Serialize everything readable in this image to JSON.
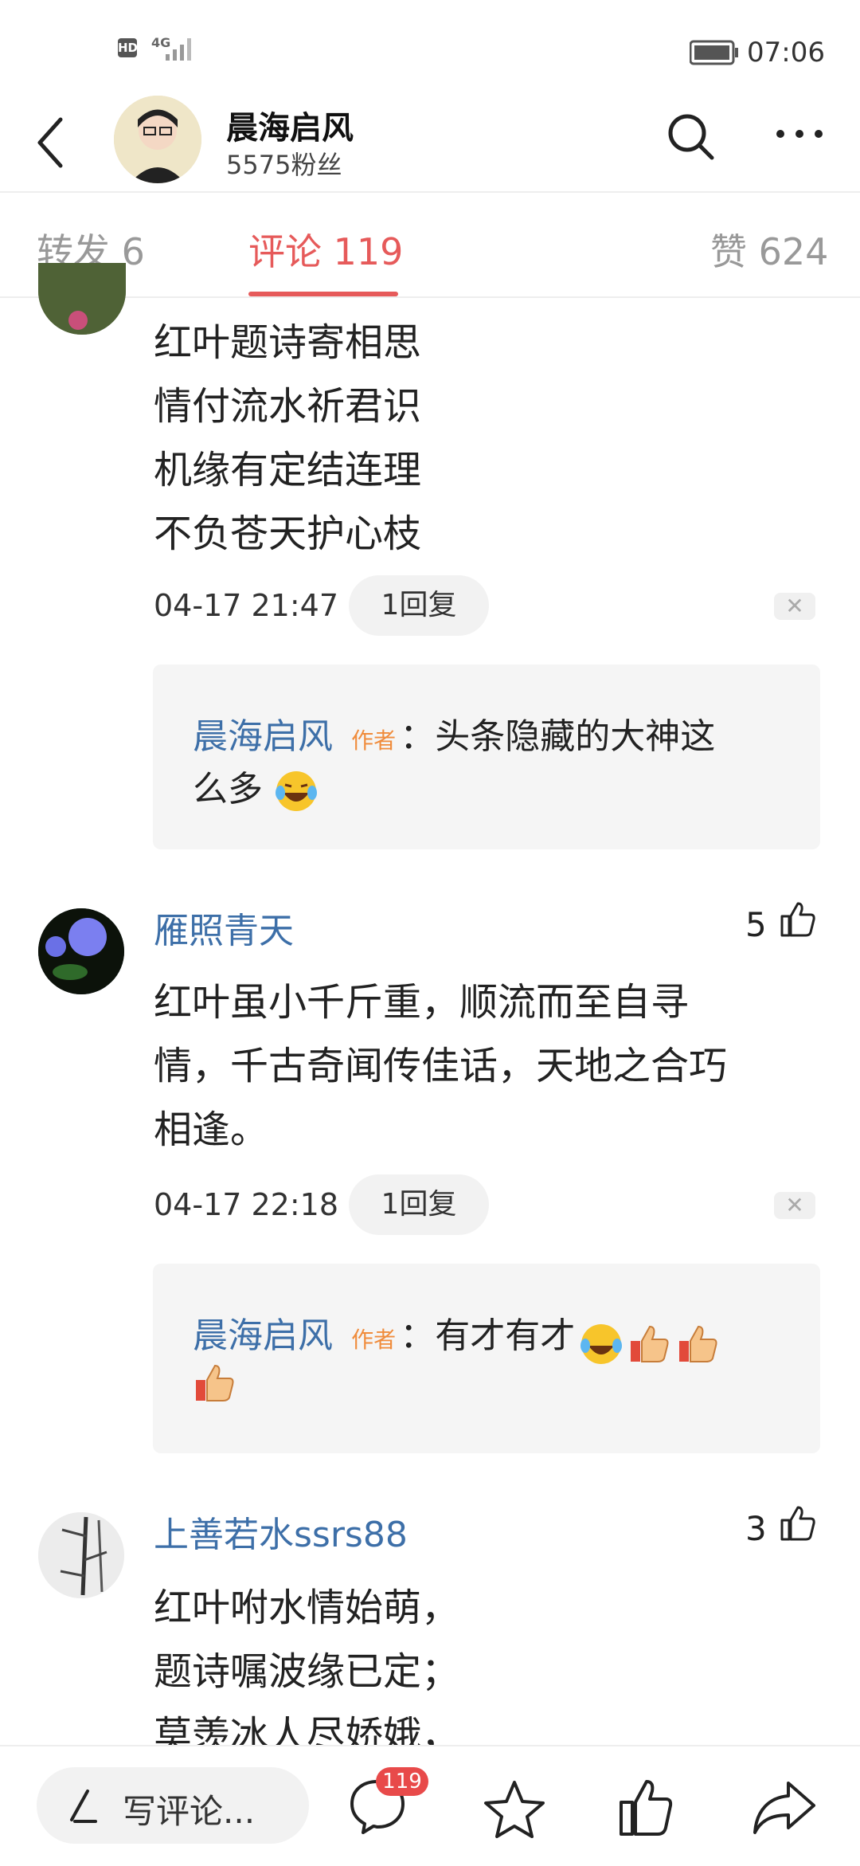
{
  "status_bar": {
    "network": "4G",
    "hd": "HD",
    "time": "07:06"
  },
  "header": {
    "name": "晨海启风",
    "followers": "5575粉丝"
  },
  "tabs": [
    {
      "label": "转发 6"
    },
    {
      "label": "评论 119"
    },
    {
      "label": "赞 624"
    }
  ],
  "comments": [
    {
      "lines": [
        "红叶题诗寄相思",
        "情付流水祈君识",
        "机缘有定结连理",
        "不负苍天护心枝"
      ],
      "time": "04-17 21:47 ·",
      "replies_label": "1回复",
      "reply": {
        "name": "晨海启风",
        "tag": "作者",
        "text1": "：头条隐藏的大神这",
        "text2": "么多"
      }
    },
    {
      "user": "雁照青天",
      "likes": "5",
      "lines": [
        "红叶虽小千斤重，顺流而至自寻",
        "情，千古奇闻传佳话，天地之合巧",
        "相逢。"
      ],
      "time": "04-17 22:18 ·",
      "replies_label": "1回复",
      "reply": {
        "name": "晨海启风",
        "tag": "作者",
        "text1": "：有才有才"
      }
    },
    {
      "user": "上善若水ssrs88",
      "likes": "3",
      "lines": [
        "红叶咐水情始萌，",
        "题诗嘱波缘已定；",
        "莫羡冰人尽娇娥，"
      ]
    }
  ],
  "bottom_bar": {
    "write_label": "写评论...",
    "comment_count": "119"
  },
  "colors": {
    "accent": "#e65a5a",
    "link": "#3d6fa8",
    "author_tag": "#f08c3c"
  }
}
